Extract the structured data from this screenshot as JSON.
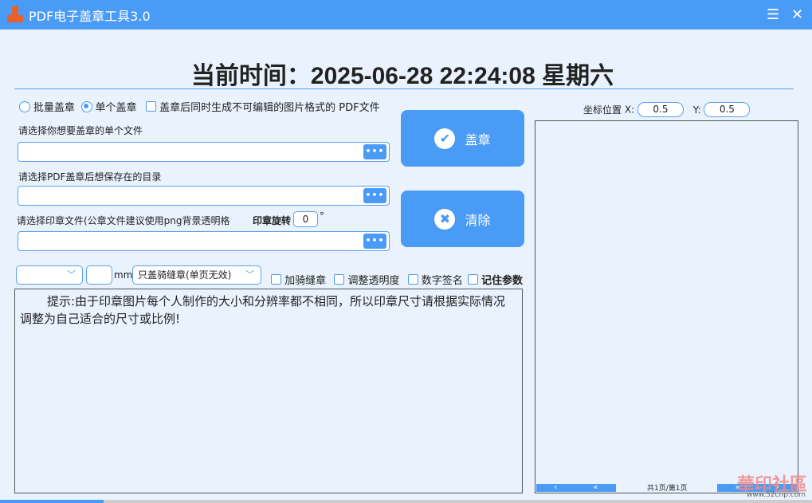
{
  "window": {
    "title": "PDF电子盖章工具3.0",
    "menu_icon": "menu-icon",
    "close_icon": "close-icon"
  },
  "clock": {
    "text": "当前时间：2025-06-28 22:24:08  星期六"
  },
  "mode": {
    "batch": "批量盖章",
    "single": "单个盖章",
    "selected": "single",
    "image_pdf_label": "盖章后同时生成不可编辑的图片格式的 PDF文件",
    "image_pdf_checked": false
  },
  "fields": {
    "file_label": "请选择你想要盖章的单个文件",
    "file_value": "",
    "dir_label": "请选择PDF盖章后想保存在的目录",
    "dir_value": "",
    "seal_label": "请选择印章文件(公章文件建议使用png背景透明格",
    "seal_value": "",
    "browse": "■■■",
    "rotation_label": "印章旋转",
    "rotation_value": "0",
    "rotation_unit": "°"
  },
  "buttons": {
    "stamp": "盖章",
    "clear": "清除",
    "stamp_icon": "✔",
    "clear_icon": "✖"
  },
  "options": {
    "size_select": "",
    "size_value": "",
    "size_unit": "mm",
    "mode_select": "只盖骑缝章(单页无效)",
    "riding_seal": "加骑缝章",
    "transparency": "调整透明度",
    "digital_sign": "数字签名",
    "remember": "记住参数"
  },
  "notes": "提示:由于印章图片每个人制作的大小和分辨率都不相同，所以印章尺寸请根据实际情况调整为自己适合的尺寸或比例!",
  "preview": {
    "coord_label": "坐标位置",
    "x_label": "X:",
    "x_value": "0.5",
    "y_label": "Y:",
    "y_value": "0.5",
    "prev": "‹",
    "first": "«",
    "next": "›",
    "last": "»",
    "page_info": "共1页/第1页"
  },
  "watermark": {
    "text": "華印社區",
    "url": "www.52cnp.com"
  }
}
